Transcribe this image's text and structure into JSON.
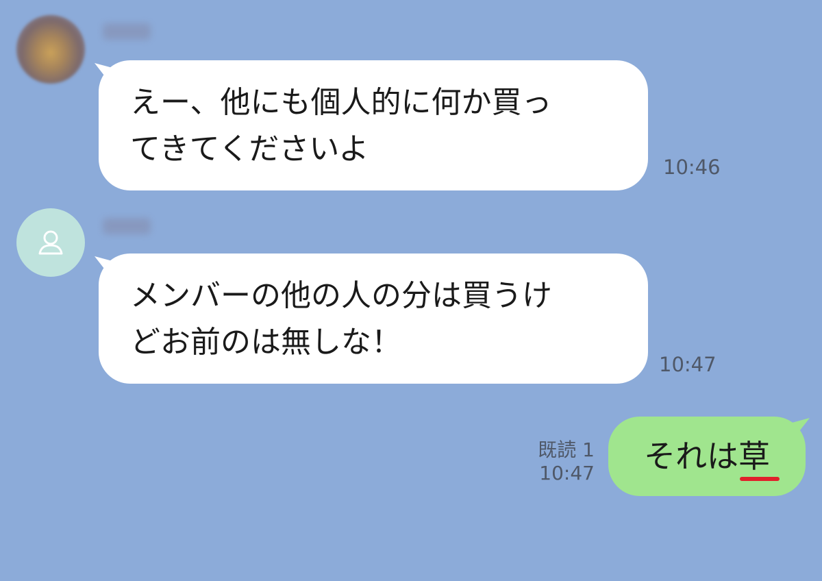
{
  "messages": [
    {
      "sender": "other",
      "text": "えー、他にも個人的に何か買っ\nてきてくださいよ",
      "time": "10:46"
    },
    {
      "sender": "other",
      "text": "メンバーの他の人の分は買うけ\nどお前のは無しな！",
      "time": "10:47"
    },
    {
      "sender": "self",
      "text_main": "それは",
      "text_highlight": "草",
      "read_status": "既読 1",
      "time": "10:47"
    }
  ],
  "icons": {
    "default_avatar": "person-outline-icon",
    "highlight_underline_color": "#e0212b"
  },
  "colors": {
    "background": "#8cabd9",
    "incoming_bubble": "#ffffff",
    "outgoing_bubble": "#a0e58e"
  }
}
